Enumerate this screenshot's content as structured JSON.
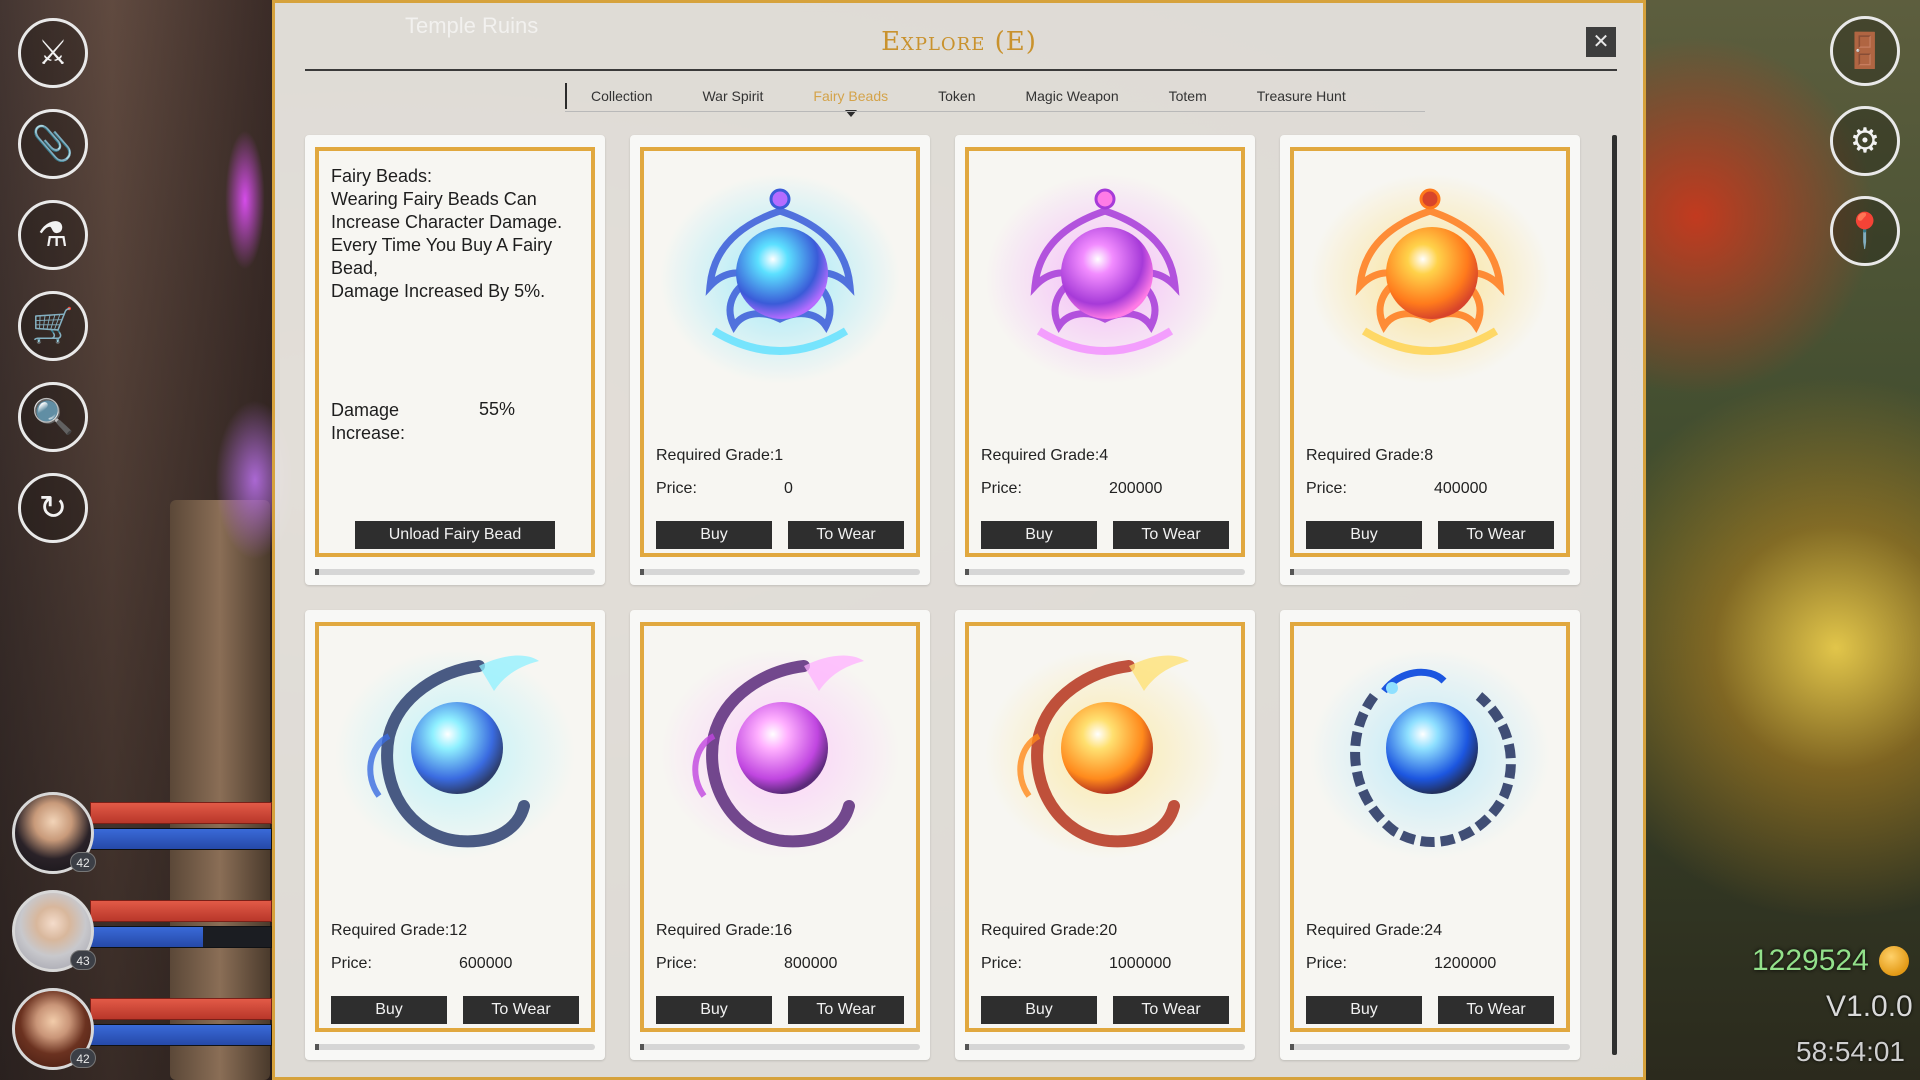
{
  "panel": {
    "ghost_title": "Temple Ruins",
    "title": "Explore (E)",
    "close_label": "✕"
  },
  "tabs": [
    {
      "label": "Collection",
      "active": false
    },
    {
      "label": "War Spirit",
      "active": false
    },
    {
      "label": "Fairy Beads",
      "active": true
    },
    {
      "label": "Token",
      "active": false
    },
    {
      "label": "Magic Weapon",
      "active": false
    },
    {
      "label": "Totem",
      "active": false
    },
    {
      "label": "Treasure Hunt",
      "active": false
    }
  ],
  "info_card": {
    "text_lines": [
      "Fairy Beads:",
      "Wearing Fairy Beads Can Increase Character Damage.",
      "Every Time You Buy A Fairy Bead,",
      "Damage Increased By 5%."
    ],
    "stat_label": "Damage Increase:",
    "stat_value": "55%",
    "unload_label": "Unload Fairy Bead"
  },
  "labels": {
    "grade_prefix": "Required Grade:",
    "price_label": "Price:",
    "buy": "Buy",
    "wear": "To Wear"
  },
  "beads": [
    {
      "grade": "Required Grade:1",
      "price": "0",
      "style": "lotus",
      "colors": [
        "#5ce0ff",
        "#3a5bd8",
        "#b46cff"
      ]
    },
    {
      "grade": "Required Grade:4",
      "price": "200000",
      "style": "lotus",
      "colors": [
        "#f28cff",
        "#a63ad8",
        "#ff7be6"
      ]
    },
    {
      "grade": "Required Grade:8",
      "price": "400000",
      "style": "lotus",
      "colors": [
        "#ffd24a",
        "#ff7a1c",
        "#d8452a"
      ]
    },
    {
      "grade": "Required Grade:12",
      "price": "600000",
      "style": "phoenix",
      "colors": [
        "#8ff0ff",
        "#3a6be0",
        "#2d3e6e"
      ]
    },
    {
      "grade": "Required Grade:16",
      "price": "800000",
      "style": "phoenix",
      "colors": [
        "#ffb0ff",
        "#c046e0",
        "#5b2a7a"
      ]
    },
    {
      "grade": "Required Grade:20",
      "price": "1000000",
      "style": "phoenix",
      "colors": [
        "#ffe070",
        "#ff8a1c",
        "#b5341f"
      ]
    },
    {
      "grade": "Required Grade:24",
      "price": "1200000",
      "style": "dragon",
      "colors": [
        "#8fe0ff",
        "#1c56e0",
        "#22305e"
      ]
    }
  ],
  "left_toolbar": [
    {
      "name": "sword-icon",
      "glyph": "⚔"
    },
    {
      "name": "paperclip-icon",
      "glyph": "📎"
    },
    {
      "name": "potion-icon",
      "glyph": "⚗"
    },
    {
      "name": "cart-icon",
      "glyph": "🛒"
    },
    {
      "name": "magnifier-icon",
      "glyph": "🔍"
    },
    {
      "name": "refresh-icon",
      "glyph": "↻"
    }
  ],
  "right_toolbar": [
    {
      "name": "door-icon",
      "glyph": "🚪"
    },
    {
      "name": "gear-icon",
      "glyph": "⚙"
    },
    {
      "name": "pin-icon",
      "glyph": "📍"
    }
  ],
  "party": [
    {
      "level": "42",
      "mp_fill": 1.0
    },
    {
      "level": "43",
      "mp_fill": 0.62
    },
    {
      "level": "42",
      "mp_fill": 1.0
    }
  ],
  "hud": {
    "gold": "1229524",
    "version": "V1.0.0",
    "timer": "58:54:01"
  }
}
